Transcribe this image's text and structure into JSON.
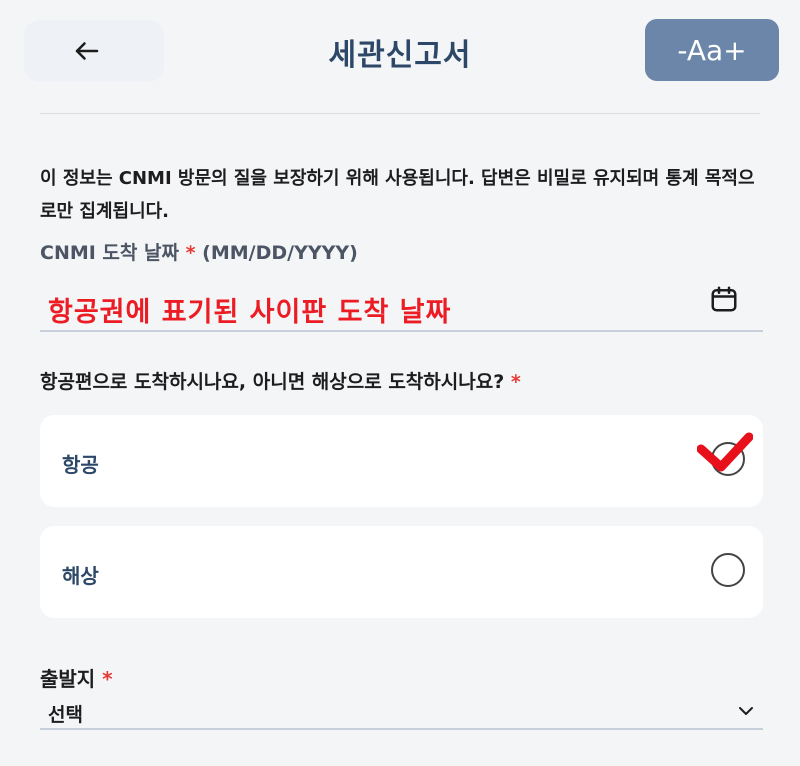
{
  "header": {
    "title": "세관신고서",
    "font_size_label": "-Aa+"
  },
  "intro_text": "이 정보는 CNMI 방문의 질을 보장하기 위해 사용됩니다. 답변은 비밀로 유지되며 통계 목적으로만 집계됩니다.",
  "arrival_date": {
    "label": "CNMI 도착 날짜",
    "required_mark": "*",
    "format": "(MM/DD/YYYY)",
    "value": "항공권에 표기된 사이판 도착 날짜"
  },
  "arrival_mode": {
    "question": "항공편으로 도착하시나요, 아니면 해상으로 도착하시나요?",
    "required_mark": "*",
    "options": [
      {
        "label": "항공",
        "selected": true
      },
      {
        "label": "해상",
        "selected": false
      }
    ]
  },
  "origin": {
    "label": "출발지",
    "required_mark": "*",
    "selected_value": "선택"
  },
  "colors": {
    "title": "#2c4768",
    "accent_button": "#6b86a8",
    "required": "#e53935",
    "annotation_red": "#ec1c24"
  }
}
